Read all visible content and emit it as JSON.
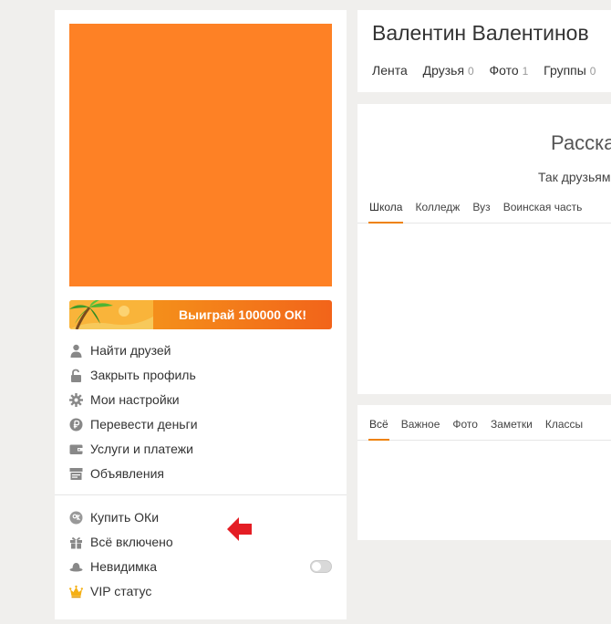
{
  "colors": {
    "accent": "#ee8208",
    "avatar": "#fe8125",
    "promo_orange": "#f48a1a",
    "arrow_red": "#e41d24"
  },
  "promo": {
    "text": "Выиграй 100000 ОК!"
  },
  "menu": {
    "items": [
      {
        "label": "Найти друзей",
        "icon": "person-icon"
      },
      {
        "label": "Закрыть профиль",
        "icon": "unlock-icon"
      },
      {
        "label": "Мои настройки",
        "icon": "gear-icon"
      },
      {
        "label": "Перевести деньги",
        "icon": "ruble-coin-icon"
      },
      {
        "label": "Услуги и платежи",
        "icon": "wallet-icon"
      },
      {
        "label": "Объявления",
        "icon": "ad-board-icon"
      }
    ],
    "extra": [
      {
        "label": "Купить ОКи",
        "icon": "ok-coin-icon"
      },
      {
        "label": "Всё включено",
        "icon": "gift-icon"
      },
      {
        "label": "Невидимка",
        "icon": "hat-icon",
        "toggle_on": false
      },
      {
        "label": "VIP статус",
        "icon": "crown-icon"
      }
    ]
  },
  "profile": {
    "name": "Валентин Валентинов",
    "nav": [
      {
        "label": "Лента",
        "count": ""
      },
      {
        "label": "Друзья",
        "count": "0"
      },
      {
        "label": "Фото",
        "count": "1"
      },
      {
        "label": "Группы",
        "count": "0"
      }
    ]
  },
  "education": {
    "title": "Расска",
    "subtitle": "Так друзьям",
    "tabs": [
      "Школа",
      "Колледж",
      "Вуз",
      "Воинская часть"
    ],
    "active_tab": 0
  },
  "feed": {
    "tabs": [
      "Всё",
      "Важное",
      "Фото",
      "Заметки",
      "Классы"
    ],
    "active_tab": 0
  }
}
